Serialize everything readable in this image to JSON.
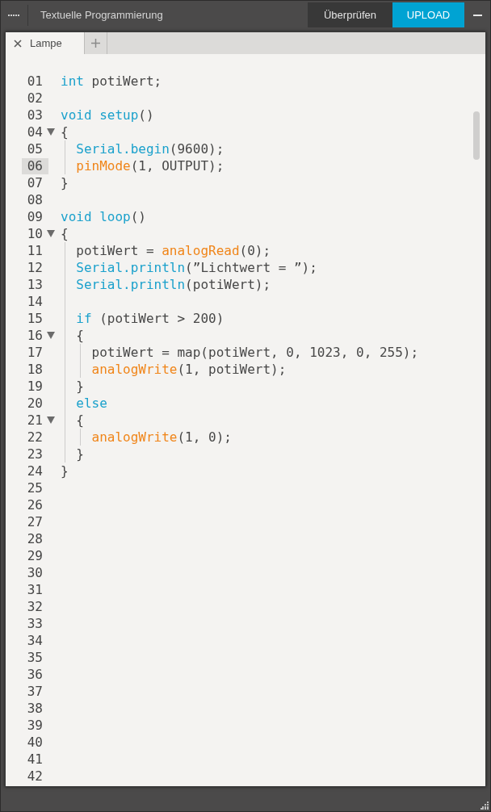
{
  "window": {
    "title": "Textuelle Programmierung"
  },
  "toolbar": {
    "buttons": [
      {
        "label": "Überprüfen",
        "kind": "secondary"
      },
      {
        "label": "UPLOAD",
        "kind": "primary"
      }
    ]
  },
  "tabs": [
    {
      "label": "Lampe",
      "selected": true
    }
  ],
  "editor": {
    "lines": [
      {
        "number": "01",
        "selected": false,
        "tokens": [
          {
            "text": "int",
            "kind": "keyword"
          },
          {
            "text": " potiWert;",
            "kind": "plain"
          }
        ]
      },
      {
        "number": "02",
        "selected": false
      },
      {
        "number": "03",
        "selected": false,
        "tokens": [
          {
            "text": "void setup",
            "kind": "keyword"
          },
          {
            "text": "()",
            "kind": "plain"
          }
        ]
      },
      {
        "number": "04",
        "selected": false,
        "expanded": true,
        "tokens": [
          {
            "text": "{",
            "kind": "plain"
          }
        ],
        "children": [
          {
            "number": "05",
            "selected": false,
            "tokens": [
              {
                "text": "Serial.begin",
                "kind": "keyword"
              },
              {
                "text": "(9600);",
                "kind": "plain"
              }
            ]
          },
          {
            "number": "06",
            "selected": true,
            "tokens": [
              {
                "text": "pinMode",
                "kind": "function"
              },
              {
                "text": "(1, OUTPUT);",
                "kind": "plain"
              }
            ]
          }
        ]
      },
      {
        "number": "07",
        "selected": false,
        "tokens": [
          {
            "text": "}",
            "kind": "plain"
          }
        ]
      },
      {
        "number": "08",
        "selected": false
      },
      {
        "number": "09",
        "selected": false,
        "tokens": [
          {
            "text": "void loop",
            "kind": "keyword"
          },
          {
            "text": "()",
            "kind": "plain"
          }
        ]
      },
      {
        "number": "10",
        "selected": false,
        "expanded": true,
        "tokens": [
          {
            "text": "{",
            "kind": "plain"
          }
        ],
        "children": [
          {
            "number": "11",
            "selected": false,
            "tokens": [
              {
                "text": "potiWert = ",
                "kind": "plain"
              },
              {
                "text": "analogRead",
                "kind": "function"
              },
              {
                "text": "(0);",
                "kind": "plain"
              }
            ]
          },
          {
            "number": "12",
            "selected": false,
            "tokens": [
              {
                "text": "Serial.println",
                "kind": "keyword"
              },
              {
                "text": "(”Lichtwert = ”);",
                "kind": "plain"
              }
            ]
          },
          {
            "number": "13",
            "selected": false,
            "tokens": [
              {
                "text": "Serial.println",
                "kind": "keyword"
              },
              {
                "text": "(potiWert);",
                "kind": "plain"
              }
            ]
          },
          {
            "number": "14",
            "selected": false
          },
          {
            "number": "15",
            "selected": false,
            "tokens": [
              {
                "text": "if",
                "kind": "keyword"
              },
              {
                "text": " (potiWert > 200)",
                "kind": "plain"
              }
            ]
          },
          {
            "number": "16",
            "selected": false,
            "expanded": true,
            "tokens": [
              {
                "text": "{",
                "kind": "plain"
              }
            ],
            "children": [
              {
                "number": "17",
                "selected": false,
                "tokens": [
                  {
                    "text": "potiWert = map(potiWert, 0, 1023, 0, 255);",
                    "kind": "plain"
                  }
                ]
              },
              {
                "number": "18",
                "selected": false,
                "tokens": [
                  {
                    "text": "analogWrite",
                    "kind": "function"
                  },
                  {
                    "text": "(1, potiWert);",
                    "kind": "plain"
                  }
                ]
              }
            ]
          },
          {
            "number": "19",
            "selected": false,
            "tokens": [
              {
                "text": "}",
                "kind": "plain"
              }
            ]
          },
          {
            "number": "20",
            "selected": false,
            "tokens": [
              {
                "text": "else",
                "kind": "keyword"
              }
            ]
          },
          {
            "number": "21",
            "selected": false,
            "expanded": true,
            "tokens": [
              {
                "text": "{",
                "kind": "plain"
              }
            ],
            "children": [
              {
                "number": "22",
                "selected": false,
                "tokens": [
                  {
                    "text": "analogWrite",
                    "kind": "function"
                  },
                  {
                    "text": "(1, 0);",
                    "kind": "plain"
                  }
                ]
              }
            ]
          },
          {
            "number": "23",
            "selected": false,
            "tokens": [
              {
                "text": "}",
                "kind": "plain"
              }
            ]
          }
        ]
      },
      {
        "number": "24",
        "selected": false,
        "tokens": [
          {
            "text": "}",
            "kind": "plain"
          }
        ]
      },
      {
        "number": "25",
        "selected": false
      },
      {
        "number": "26",
        "selected": false
      },
      {
        "number": "27",
        "selected": false
      },
      {
        "number": "28",
        "selected": false
      },
      {
        "number": "29",
        "selected": false
      },
      {
        "number": "30",
        "selected": false
      },
      {
        "number": "31",
        "selected": false
      },
      {
        "number": "32",
        "selected": false
      },
      {
        "number": "33",
        "selected": false
      },
      {
        "number": "34",
        "selected": false
      },
      {
        "number": "35",
        "selected": false
      },
      {
        "number": "36",
        "selected": false
      },
      {
        "number": "37",
        "selected": false
      },
      {
        "number": "38",
        "selected": false
      },
      {
        "number": "39",
        "selected": false
      },
      {
        "number": "40",
        "selected": false
      },
      {
        "number": "41",
        "selected": false
      },
      {
        "number": "42",
        "selected": false
      }
    ]
  }
}
